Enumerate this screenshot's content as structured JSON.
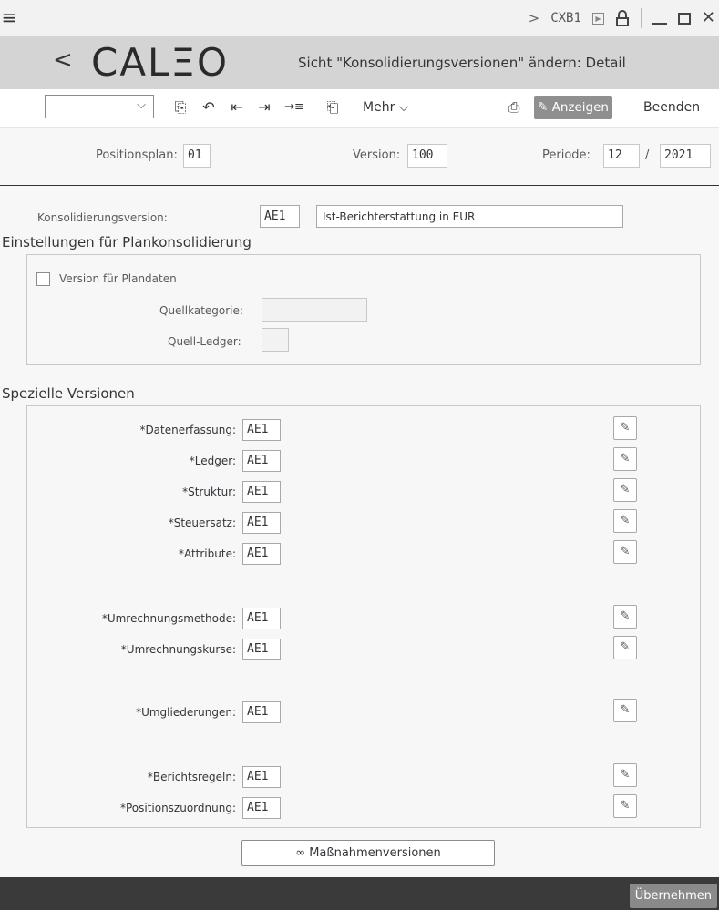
{
  "titlebar": {
    "transaction": "CXB1"
  },
  "header": {
    "logo": "CALΞO",
    "title": "Sicht \"Konsolidierungsversionen\" ändern: Detail"
  },
  "toolbar": {
    "more_label": "Mehr",
    "display_label": "Anzeigen",
    "exit_label": "Beenden",
    "select_value": ""
  },
  "hdr_fields": {
    "positionsplan_label": "Positionsplan:",
    "positionsplan_value": "01",
    "version_label": "Version:",
    "version_value": "100",
    "periode_label": "Periode:",
    "periode_value": "12",
    "periode_sep": "/",
    "year_value": "2021"
  },
  "konsolidierung": {
    "label": "Konsolidierungsversion:",
    "code": "AE1",
    "description": "Ist-Berichterstattung in EUR"
  },
  "plan": {
    "title": "Einstellungen für Plankonsolidierung",
    "checkbox_label": "Version für Plandaten",
    "quellkategorie_label": "Quellkategorie:",
    "quellkategorie_value": "",
    "quellledger_label": "Quell-Ledger:",
    "quellledger_value": ""
  },
  "special": {
    "title": "Spezielle Versionen",
    "rows": [
      {
        "label": "Datenerfassung:",
        "value": "AE1"
      },
      {
        "label": "Ledger:",
        "value": "AE1"
      },
      {
        "label": "Struktur:",
        "value": "AE1"
      },
      {
        "label": "Steuersatz:",
        "value": "AE1"
      },
      {
        "label": "Attribute:",
        "value": "AE1"
      },
      {
        "label": "Umrechnungsmethode:",
        "value": "AE1"
      },
      {
        "label": "Umrechnungskurse:",
        "value": "AE1"
      },
      {
        "label": "Umgliederungen:",
        "value": "AE1"
      },
      {
        "label": "Berichtsregeln:",
        "value": "AE1"
      },
      {
        "label": "Positionszuordnung:",
        "value": "AE1"
      }
    ]
  },
  "massnahmen_label": "Maßnahmenversionen",
  "footer": {
    "apply_label": "Übernehmen"
  }
}
